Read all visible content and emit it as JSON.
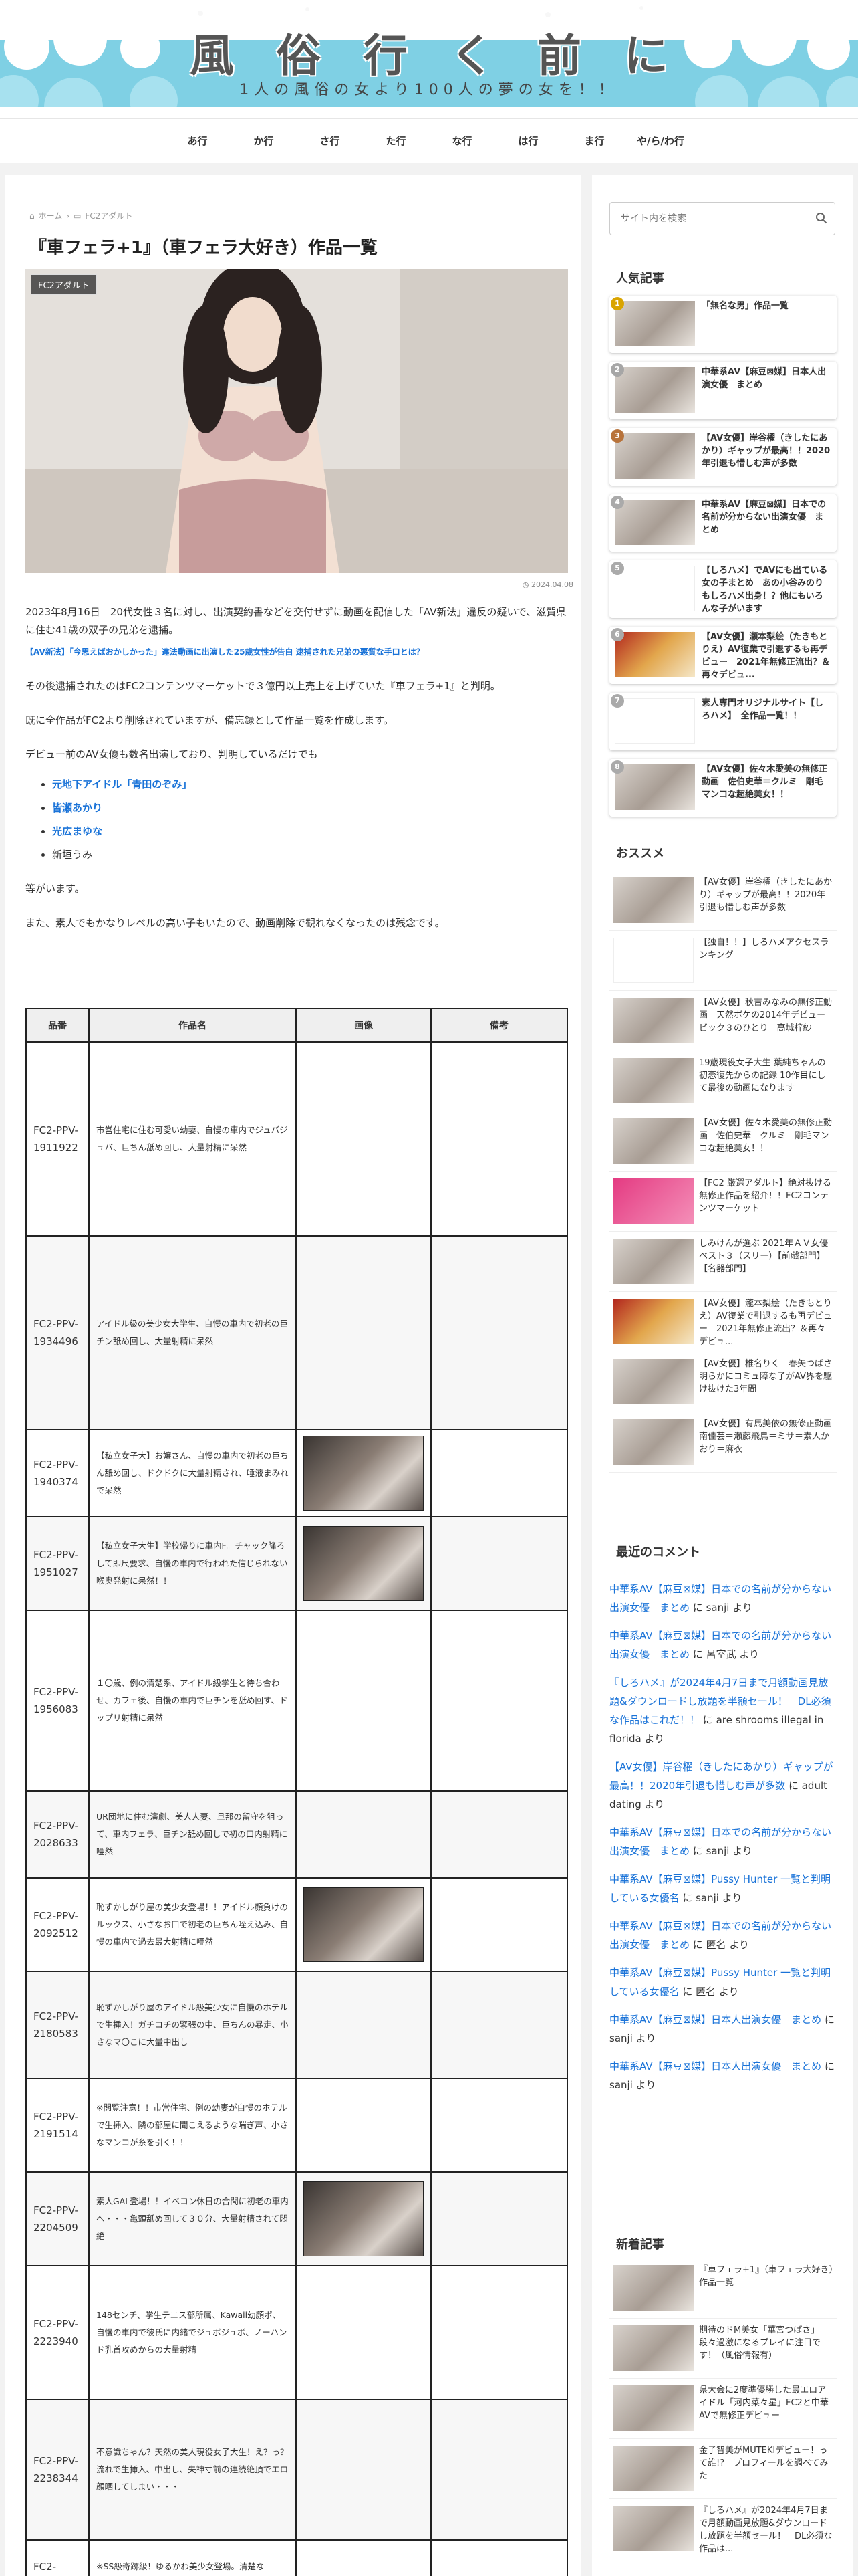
{
  "header": {
    "site_title": "風俗行く前に",
    "tagline": "1人の風俗の女より100人の夢の女を！！",
    "nav": [
      "あ行",
      "か行",
      "さ行",
      "た行",
      "な行",
      "は行",
      "ま行",
      "や/ら/わ行"
    ]
  },
  "breadcrumb": {
    "home": "ホーム",
    "category": "FC2アダルト"
  },
  "article": {
    "title": "『車フェラ+1』（車フェラ大好き）作品一覧",
    "category_label": "FC2アダルト",
    "date": "2024.04.08",
    "para1": "2023年8月16日　20代女性３名に対し、出演契約書などを交付せずに動画を配信した「AV新法」違反の疑いで、滋賀県に住む41歳の双子の兄弟を逮捕。",
    "small_link": "【AV新法】「今思えばおかしかった」違法動画に出演した25歳女性が告白 逮捕された兄弟の悪質な手口とは？",
    "para2": "その後逮捕されたのはFC2コンテンツマーケットで３億円以上売上を上げていた『車フェラ+1』と判明。",
    "para3": "既に全作品がFC2より削除されていますが、備忘録として作品一覧を作成します。",
    "para4": "デビュー前のAV女優も数名出演しており、判明しているだけでも",
    "actresses": [
      "元地下アイドル「青田のぞみ」",
      "皆瀬あかり",
      "光広まゆな",
      "新垣うみ"
    ],
    "para5": "等がいます。",
    "para6": "また、素人でもかなりレベルの高い子もいたので、動画削除で観れなくなったのは残念です。"
  },
  "table": {
    "headers": [
      "品番",
      "作品名",
      "画像",
      "備考"
    ],
    "rows": [
      {
        "code": "FC2-PPV-1911922",
        "name": "市営住宅に住む可愛い幼妻、自慢の車内でジュバジュバ、巨ちん舐め回し、大量射精に呆然",
        "img": false
      },
      {
        "code": "FC2-PPV-1934496",
        "name": "アイドル級の美少女大学生、自慢の車内で初老の巨チン舐め回し、大量射精に呆然",
        "img": false
      },
      {
        "code": "FC2-PPV-1940374",
        "name": "【私立女子大】お嬢さん、自慢の車内で初老の巨ちん舐め回し、ドクドクに大量射精され、唾液まみれで呆然",
        "img": true
      },
      {
        "code": "FC2-PPV-1951027",
        "name": "【私立女子大生】学校帰りに車内F。チャック降ろして即尺要求、自慢の車内で行われた信じられない喉奥発射に呆然！！",
        "img": true
      },
      {
        "code": "FC2-PPV-1956083",
        "name": "１〇歳、例の清楚系、アイドル級学生と待ち合わせ、カフェ後、自慢の車内で巨チンを舐め回す、ドップリ射精に呆然",
        "img": false
      },
      {
        "code": "FC2-PPV-2028633",
        "name": "UR団地に住む演劇、美人人妻、旦那の留守を狙って、車内フェラ、巨チン舐め回しで初の口内射精に唖然",
        "img": false
      },
      {
        "code": "FC2-PPV-2092512",
        "name": "恥ずかしがり屋の美少女登場！！アイドル顔負けのルックス、小さなお口で初老の巨ちん咥え込み、自慢の車内で過去最大射精に唖然",
        "img": true
      },
      {
        "code": "FC2-PPV-2180583",
        "name": "恥ずかしがり屋のアイドル級美少女に自慢のホテルで生挿入！ガチコチの緊張の中、巨ちんの暴走、小さなマ〇こに大量中出し",
        "img": false
      },
      {
        "code": "FC2-PPV-2191514",
        "name": "※閲覧注意！！市営住宅、例の幼妻が自慢のホテルで生挿入、隣の部屋に聞こえるような喘ぎ声、小さなマンコが糸を引く！！",
        "img": false
      },
      {
        "code": "FC2-PPV-2204509",
        "name": "素人GAL登場！！イベコン休日の合間に初老の車内へ・・・亀頭舐め回して３０分、大量射精されて悶絶",
        "img": true
      },
      {
        "code": "FC2-PPV-2223940",
        "name": "148センチ、学生テニス部所属、Kawaii幼顔ボ、自慢の車内で彼氏に内緒でジュボジュボ、ノーハンド乳首攻めからの大量射精",
        "img": false
      },
      {
        "code": "FC2-PPV-2238344",
        "name": "不意識ちゃん？天然の美人現役女子大生！え？っ？流れで生挿入、中出し、失神寸前の連続絶頂でエロ顔晒してしまい・・・",
        "img": false
      },
      {
        "code": "FC2-",
        "name": "※SS級奇跡級！ゆるかわ美少女登場。清楚な",
        "img": false
      }
    ]
  },
  "sidebar": {
    "search_placeholder": "サイト内を検索",
    "popular_title": "人気記事",
    "popular": [
      {
        "rank": "1",
        "title": "「無名な男」作品一覧"
      },
      {
        "rank": "2",
        "title": "中華系AV【麻豆⊠媒】日本人出演女優　まとめ"
      },
      {
        "rank": "3",
        "title": "【AV女優】岸谷櫂（きしたにあかり）ギャップが最高！！2020年引退も惜しむ声が多数"
      },
      {
        "rank": "4",
        "title": "中華系AV【麻豆⊠媒】日本での名前が分からない出演女優　まとめ"
      },
      {
        "rank": "5",
        "title": "【しろハメ】でAVにも出ている女の子まとめ　あの小谷みのりもしろハメ出身！？他にもいろんな子がいます"
      },
      {
        "rank": "6",
        "title": "【AV女優】瀬本梨絵（たきもとりえ）AV復業で引退するも再デビュー　2021年無修正流出？＆再々デビュ..."
      },
      {
        "rank": "7",
        "title": "素人専門オリジナルサイト【しろハメ】　全作品一覧！！"
      },
      {
        "rank": "8",
        "title": "【AV女優】佐々木愛美の無修正動画　佐伯史華＝クルミ　剛毛マンコな超絶美女！！"
      }
    ],
    "recommend_title": "おススメ",
    "recommend": [
      "【AV女優】岸谷櫂（きしたにあかり）ギャップが最高！！2020年引退も惜しむ声が多数",
      "【独自！！】しろハメアクセスランキング",
      "【AV女優】秋吉みなみの無修正動画　天然ボケの2014年デビュー ビック３のひとり　高城梓紗",
      "19歳現役女子大生 葉純ちゃんの初恋復先からの記録 10作目にして最後の動画になります",
      "【AV女優】佐々木愛美の無修正動画　佐伯史華＝クルミ　剛毛マンコな超絶美女！！",
      "【FC2 厳選アダルト】絶対抜ける無修正作品を紹介！！FC2コンテンツマーケット",
      "しみけんが選ぶ 2021年ＡＶ女優ベスト３（スリー）【前戯部門】【名器部門】",
      "【AV女優】瀧本梨絵（たきもとりえ）AV復業で引退するも再デビュー　2021年無修正流出？＆再々デビュ...",
      "【AV女優】椎名りく＝春矢つばさ　明らかにコミュ障な子がAV界を駆け抜けた3年間",
      "【AV女優】有馬美依の無修正動画　南佳芸＝瀬藤飛鳥＝ミサ＝素人かおり＝麻衣"
    ],
    "comments_title": "最近のコメント",
    "comments": [
      {
        "link": "中華系AV【麻豆⊠媒】日本での名前が分からない出演女優　まとめ",
        "by": "に sanji より"
      },
      {
        "link": "中華系AV【麻豆⊠媒】日本での名前が分からない出演女優　まとめ",
        "by": "に 呂室武 より"
      },
      {
        "link": "『しろハメ』が2024年4月7日まで月額動画見放題&ダウンロードし放題を半額セール！　DL必須な作品はこれだ！！",
        "by": "に are shrooms illegal in florida より"
      },
      {
        "link": "【AV女優】岸谷櫂（きしたにあかり）ギャップが最高！！2020年引退も惜しむ声が多数",
        "by": "に adult dating より"
      },
      {
        "link": "中華系AV【麻豆⊠媒】日本での名前が分からない出演女優　まとめ",
        "by": "に sanji より"
      },
      {
        "link": "中華系AV【麻豆⊠媒】Pussy Hunter 一覧と判明している女優名",
        "by": "に sanji より"
      },
      {
        "link": "中華系AV【麻豆⊠媒】日本での名前が分からない出演女優　まとめ",
        "by": "に 匿名 より"
      },
      {
        "link": "中華系AV【麻豆⊠媒】Pussy Hunter 一覧と判明している女優名",
        "by": "に 匿名 より"
      },
      {
        "link": "中華系AV【麻豆⊠媒】日本人出演女優　まとめ",
        "by": "に sanji より"
      },
      {
        "link": "中華系AV【麻豆⊠媒】日本人出演女優　まとめ",
        "by": "に sanji より"
      }
    ],
    "new_title": "新着記事",
    "new_posts": [
      "『車フェラ+1』（車フェラ大好き）作品一覧",
      "期待のドM美女「華宮つばさ」段々過激になるプレイに注目です！（風俗情報有）",
      "県大会に2度準優勝した最エロアイドル「河内菜々星」FC2と中華AVで無修正デビュー",
      "金子智美がMUTEKIデビュー！って誰!?　プロフィールを調べてみた",
      "『しろハメ』が2024年4月7日まで月額動画見放題&ダウンロードし放題を半額セール！　DL必須な作品は..."
    ]
  }
}
